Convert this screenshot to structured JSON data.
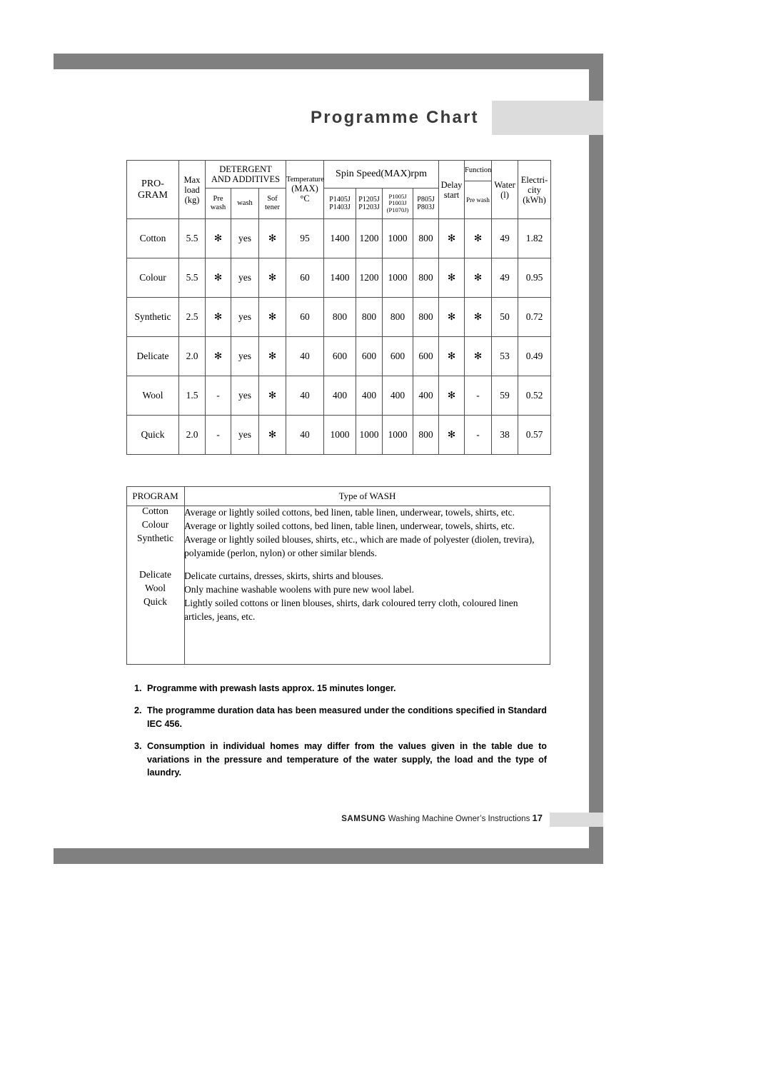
{
  "page": {
    "title": "Programme Chart",
    "footer_brand": "SAMSUNG",
    "footer_text": "Washing Machine Owner’s Instructions",
    "footer_page": "17"
  },
  "programme_table": {
    "headers": {
      "program": "PRO-\nGRAM",
      "program_l1": "PRO-",
      "program_l2": "GRAM",
      "max_load_l1": "Max",
      "max_load_l2": "load",
      "max_load_l3": "(kg)",
      "detergent_l1": "DETERGENT",
      "detergent_l2": "AND ADDITIVES",
      "prewash_l1": "Pre",
      "prewash_l2": "wash",
      "wash": "wash",
      "softener_l1": "Sof",
      "softener_l2": "tener",
      "temperature_l1": "Temperature",
      "temperature_l2": "(MAX)",
      "temperature_l3": "°C",
      "spin_speed": "Spin Speed(MAX)rpm",
      "model_1_l1": "P1405J",
      "model_1_l2": "P1403J",
      "model_2_l1": "P1205J",
      "model_2_l2": "P1203J",
      "model_3_l1": "P1005J",
      "model_3_l2": "P1003J",
      "model_3_l3": "(P1070J)",
      "model_4_l1": "P805J",
      "model_4_l2": "P803J",
      "delay_l1": "Delay",
      "delay_l2": "start",
      "function": "Function",
      "function_prewash": "Pre wash",
      "water_l1": "Water",
      "water_l2": "(l)",
      "electricity_l1": "Electri-",
      "electricity_l2": "city",
      "electricity_l3": "(kWh)"
    },
    "rows": [
      {
        "program": "Cotton",
        "max_load": "5.5",
        "prewash": "✻",
        "wash": "yes",
        "softener": "✻",
        "temperature": "95",
        "spin_1": "1400",
        "spin_2": "1200",
        "spin_3": "1000",
        "spin_4": "800",
        "delay_start": "✻",
        "function_prewash": "✻",
        "water": "49",
        "electricity": "1.82"
      },
      {
        "program": "Colour",
        "max_load": "5.5",
        "prewash": "✻",
        "wash": "yes",
        "softener": "✻",
        "temperature": "60",
        "spin_1": "1400",
        "spin_2": "1200",
        "spin_3": "1000",
        "spin_4": "800",
        "delay_start": "✻",
        "function_prewash": "✻",
        "water": "49",
        "electricity": "0.95"
      },
      {
        "program": "Synthetic",
        "max_load": "2.5",
        "prewash": "✻",
        "wash": "yes",
        "softener": "✻",
        "temperature": "60",
        "spin_1": "800",
        "spin_2": "800",
        "spin_3": "800",
        "spin_4": "800",
        "delay_start": "✻",
        "function_prewash": "✻",
        "water": "50",
        "electricity": "0.72"
      },
      {
        "program": "Delicate",
        "max_load": "2.0",
        "prewash": "✻",
        "wash": "yes",
        "softener": "✻",
        "temperature": "40",
        "spin_1": "600",
        "spin_2": "600",
        "spin_3": "600",
        "spin_4": "600",
        "delay_start": "✻",
        "function_prewash": "✻",
        "water": "53",
        "electricity": "0.49"
      },
      {
        "program": "Wool",
        "max_load": "1.5",
        "prewash": "-",
        "wash": "yes",
        "softener": "✻",
        "temperature": "40",
        "spin_1": "400",
        "spin_2": "400",
        "spin_3": "400",
        "spin_4": "400",
        "delay_start": "✻",
        "function_prewash": "-",
        "water": "59",
        "electricity": "0.52"
      },
      {
        "program": "Quick",
        "max_load": "2.0",
        "prewash": "-",
        "wash": "yes",
        "softener": "✻",
        "temperature": "40",
        "spin_1": "1000",
        "spin_2": "1000",
        "spin_3": "1000",
        "spin_4": "800",
        "delay_start": "✻",
        "function_prewash": "-",
        "water": "38",
        "electricity": "0.57"
      }
    ]
  },
  "wash_table": {
    "header_program": "PROGRAM",
    "header_type": "Type of  WASH",
    "rows": [
      {
        "program": "Cotton",
        "description": "Average or lightly soiled cottons, bed linen, table linen, underwear, towels, shirts, etc."
      },
      {
        "program": "Colour",
        "description": "Average or lightly soiled cottons, bed linen, table linen, underwear, towels, shirts, etc."
      },
      {
        "program": "Synthetic",
        "description": "Average or lightly soiled blouses, shirts, etc., which are made of polyester (diolen, trevira), polyamide (perlon, nylon) or other similar blends."
      },
      {
        "program": "Delicate",
        "description": "Delicate curtains, dresses, skirts, shirts and blouses."
      },
      {
        "program": "Wool",
        "description": "Only machine washable woolens with pure new wool label."
      },
      {
        "program": "Quick",
        "description": "Lightly soiled cottons or linen blouses, shirts, dark coloured terry cloth, coloured linen articles, jeans, etc."
      }
    ]
  },
  "notes": [
    {
      "num": "1.",
      "text": "Programme with prewash lasts approx. 15 minutes longer."
    },
    {
      "num": "2.",
      "text": "The programme duration data has been measured under the conditions specified in Standard IEC 456."
    },
    {
      "num": "3.",
      "text": "Consumption in individual homes may differ from the values given in the table due to variations in the pressure and temperature of the water supply, the load and the type of laundry."
    }
  ]
}
